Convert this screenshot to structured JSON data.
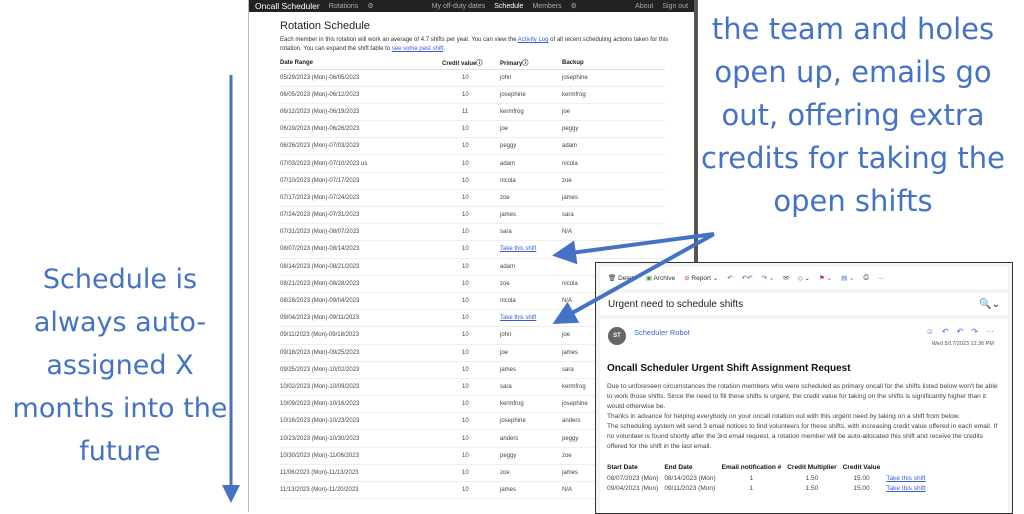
{
  "captions": {
    "left": "Schedule is always auto-assigned X months into the future",
    "right": "the team and holes open up, emails go out, offering extra credits for taking the open shifts"
  },
  "nav": {
    "brand": "Oncall Scheduler",
    "rotations": "Rotations",
    "offduty": "My off-duty dates",
    "schedule": "Schedule",
    "members": "Members",
    "about": "About",
    "signout": "Sign out"
  },
  "page": {
    "title": "Rotation Schedule",
    "intro1": "Each member in this rotation will work an average of 4.7 shifts per year. You can view the ",
    "activity_link": "Activity Log",
    "intro2": " of all recent scheduling actions taken for this rotation. You can expand the shift table to ",
    "past_link": "see some past shift",
    "intro3": "."
  },
  "table": {
    "headers": [
      "Date Range",
      "Credit valueⓘ",
      "Primaryⓘ",
      "Backup"
    ],
    "rows": [
      [
        "05/29/2023 (Mon)-06/05/2023",
        "10",
        "john",
        "josephine"
      ],
      [
        "06/05/2023 (Mon)-06/12/2023",
        "10",
        "josephine",
        "kermfrog"
      ],
      [
        "06/12/2023 (Mon)-06/19/2023",
        "11",
        "kermfrog",
        "joe"
      ],
      [
        "06/19/2023 (Mon)-06/26/2023",
        "10",
        "joe",
        "peggy"
      ],
      [
        "06/26/2023 (Mon)-07/03/2023",
        "10",
        "peggy",
        "adam"
      ],
      [
        "07/03/2023 (Mon)-07/10/2023 us",
        "10",
        "adam",
        "nicola"
      ],
      [
        "07/10/2023 (Mon)-07/17/2023",
        "10",
        "nicola",
        "zoe"
      ],
      [
        "07/17/2023 (Mon)-07/24/2023",
        "10",
        "zoe",
        "james"
      ],
      [
        "07/24/2023 (Mon)-07/31/2023",
        "10",
        "james",
        "sara"
      ],
      [
        "07/31/2023 (Mon)-08/07/2023",
        "10",
        "sara",
        "N/A"
      ],
      [
        "08/07/2023 (Mon)-08/14/2023",
        "10",
        "Take this shift",
        ""
      ],
      [
        "08/14/2023 (Mon)-08/21/2023",
        "10",
        "adam",
        ""
      ],
      [
        "08/21/2023 (Mon)-08/28/2023",
        "10",
        "zoe",
        "nicola"
      ],
      [
        "08/28/2023 (Mon)-09/04/2023",
        "10",
        "nicola",
        "N/A"
      ],
      [
        "09/04/2023 (Mon)-09/11/2023",
        "10",
        "Take this shift",
        "john"
      ],
      [
        "09/11/2023 (Mon)-09/18/2023",
        "10",
        "john",
        "joe"
      ],
      [
        "09/18/2023 (Mon)-09/25/2023",
        "10",
        "joe",
        "james"
      ],
      [
        "09/25/2023 (Mon)-10/02/2023",
        "10",
        "james",
        "sara"
      ],
      [
        "10/02/2023 (Mon)-10/09/2023",
        "10",
        "sara",
        "kermfrog"
      ],
      [
        "10/09/2023 (Mon)-10/16/2023",
        "10",
        "kermfrog",
        "josephine"
      ],
      [
        "10/16/2023 (Mon)-10/23/2023",
        "10",
        "josephine",
        "anders"
      ],
      [
        "10/23/2023 (Mon)-10/30/2023",
        "10",
        "anders",
        "peggy"
      ],
      [
        "10/30/2023 (Mon)-11/06/2023",
        "10",
        "peggy",
        "zoe"
      ],
      [
        "11/06/2023 (Mon)-11/13/2023",
        "10",
        "zoe",
        "james"
      ],
      [
        "11/13/2023 (Mon)-11/20/2023",
        "10",
        "james",
        "N/A"
      ]
    ]
  },
  "email": {
    "toolbar": [
      "Delete",
      "Archive",
      "Report"
    ],
    "subject": "Urgent need to schedule shifts",
    "avatar": "ST",
    "from": "Scheduler Robot",
    "date": "Wed 5/17/2023 12:36 PM",
    "heading": "Oncall Scheduler Urgent Shift Assignment Request",
    "p1": "Due to unforeseen circumstances the rotation members who were scheduled as primary oncall for the shifts listed below won't be able to work those shifts. Since the need to fill these shifts is urgent, the credit value for taking on the shifts is significantly higher than it would otherwise be.",
    "p2": "Thanks in advance for helping everybody on your oncall rotation out with this urgent need by taking on a shift from below.",
    "p3": "The scheduling system will send 3 email notices to find volunteers for these shifts, with increasing credit value offered in each email. If no volunteer is found shortly after the 3rd email request, a rotation member will be auto-allocated this shift and receive the credits offered for the shift in the last email.",
    "headers": [
      "Start Date",
      "End Date",
      "Email notification #",
      "Credit Multiplier",
      "Credit Value",
      ""
    ],
    "rows": [
      [
        "08/07/2023 (Mon)",
        "08/14/2023 (Mon)",
        "1",
        "1.50",
        "15.00",
        "Take this shift"
      ],
      [
        "09/04/2023 (Mon)",
        "09/11/2023 (Mon)",
        "1",
        "1.50",
        "15.00",
        "Take this shift"
      ]
    ]
  },
  "colors": {
    "accent": "#4472C4",
    "link": "#3a5bd9",
    "nav": "#222222"
  }
}
